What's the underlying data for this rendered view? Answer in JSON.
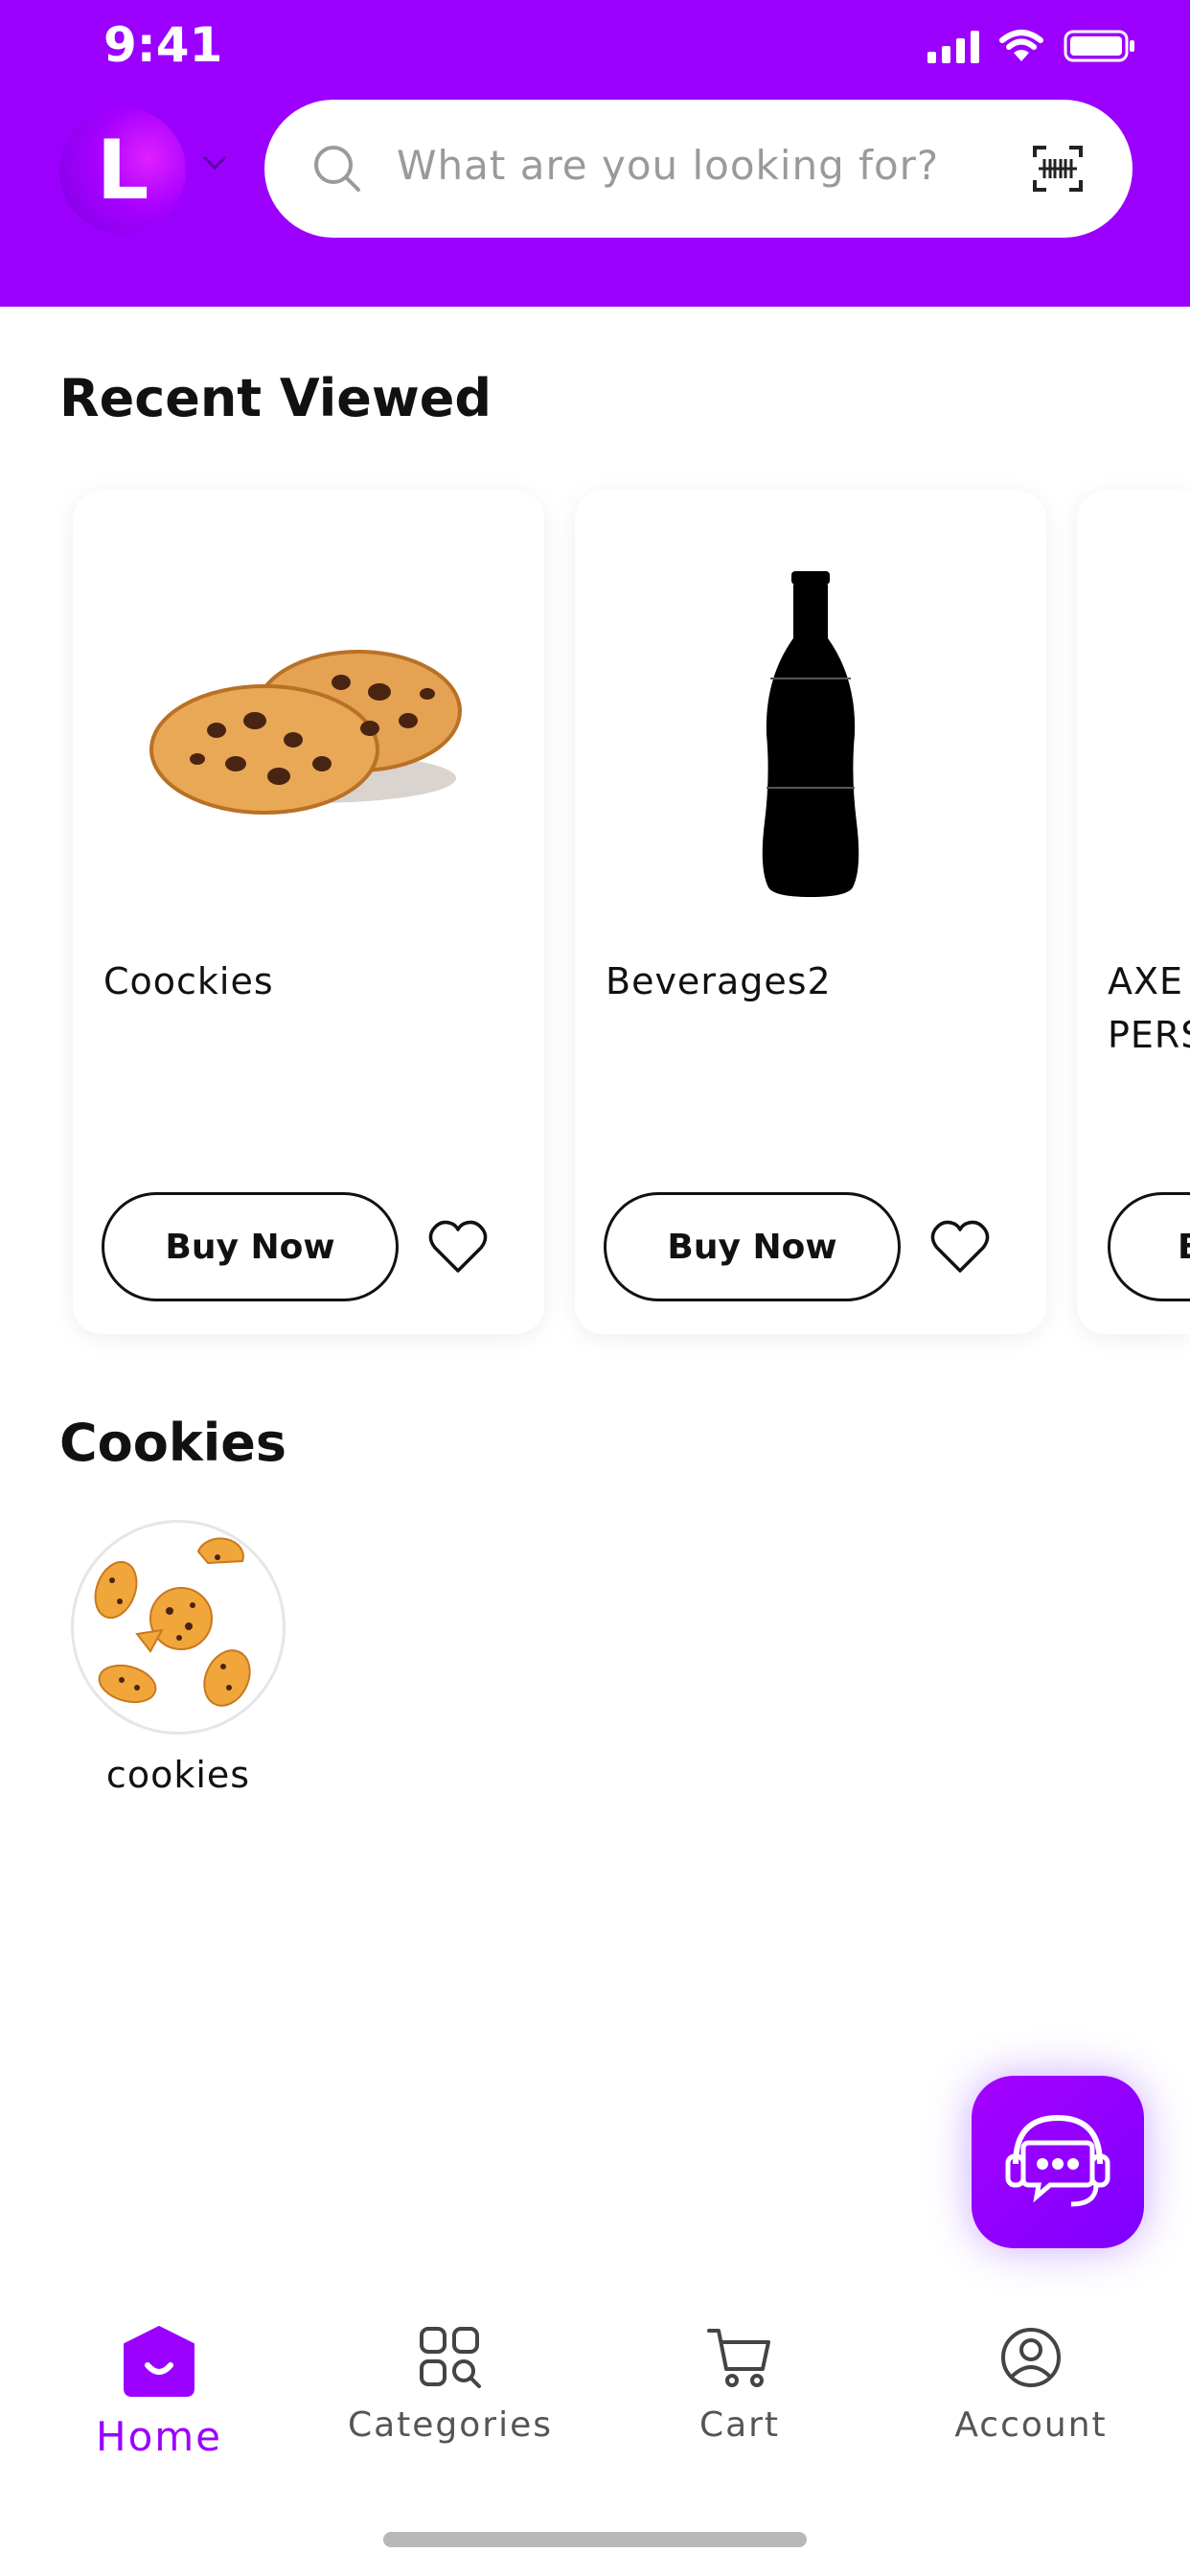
{
  "status_bar": {
    "time": "9:41"
  },
  "header": {
    "avatar_letter": "L",
    "search_placeholder": "What are you looking for?"
  },
  "recent": {
    "title": "Recent Viewed",
    "items": [
      {
        "name": "Coockies",
        "button": "Buy Now"
      },
      {
        "name": "Beverages2",
        "button": "Buy Now"
      },
      {
        "name": "AXE A\nPERS",
        "button": "B"
      }
    ]
  },
  "cookies_section": {
    "title": "Cookies",
    "categories": [
      {
        "label": "cookies"
      }
    ]
  },
  "tabbar": {
    "tabs": [
      {
        "label": "Home",
        "icon": "home-icon",
        "active": true
      },
      {
        "label": "Categories",
        "icon": "categories-icon",
        "active": false
      },
      {
        "label": "Cart",
        "icon": "cart-icon",
        "active": false
      },
      {
        "label": "Account",
        "icon": "account-icon",
        "active": false
      }
    ]
  },
  "colors": {
    "brand": "#9b00ff",
    "text": "#111111",
    "muted": "#9a9a9a"
  }
}
